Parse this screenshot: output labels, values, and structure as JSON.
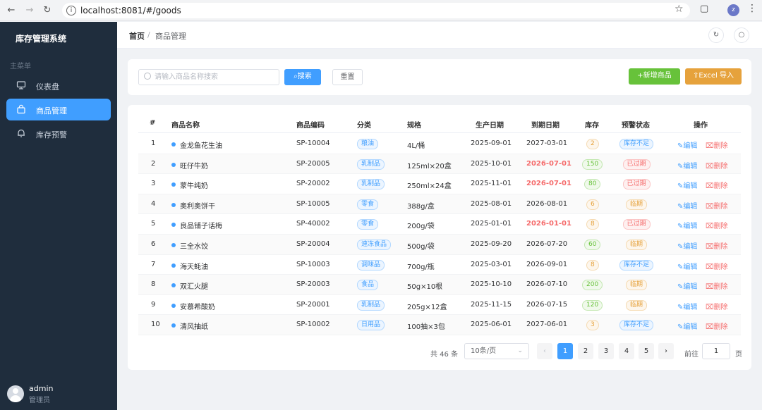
{
  "browser": {
    "url": "localhost:8081/#/goods",
    "profile_initial": "z"
  },
  "sidebar": {
    "brand": "库存管理系统",
    "section_label": "主菜单",
    "items": [
      {
        "label": "仪表盘",
        "icon": "monitor-icon"
      },
      {
        "label": "商品管理",
        "icon": "shopping-bag-icon"
      },
      {
        "label": "库存预警",
        "icon": "bell-icon"
      }
    ],
    "user": {
      "name": "admin",
      "role": "管理员"
    }
  },
  "header": {
    "breadcrumb_home": "首页",
    "breadcrumb_separator": "/",
    "breadcrumb_current": "商品管理"
  },
  "toolbar": {
    "search_placeholder": "请输入商品名称搜索",
    "search_value": "",
    "search_button": "搜索",
    "reset_button": "重置",
    "add_button": "+新增商品",
    "import_button": "Excel 导入"
  },
  "table": {
    "columns": [
      "#",
      "商品名称",
      "商品编码",
      "分类",
      "规格",
      "生产日期",
      "到期日期",
      "库存",
      "预警状态",
      "操作"
    ],
    "edit_label": "编辑",
    "delete_label": "删除",
    "rows": [
      {
        "idx": "1",
        "name": "金龙鱼花生油",
        "code": "SP-10004",
        "category": "粮油",
        "spec": "4L/桶",
        "prod": "2025-09-01",
        "exp": "2027-03-01",
        "exp_expired": false,
        "stock": "2",
        "stock_level": "low",
        "status": "库存不足",
        "status_type": "info"
      },
      {
        "idx": "2",
        "name": "旺仔牛奶",
        "code": "SP-20005",
        "category": "乳制品",
        "spec": "125ml×20盒",
        "prod": "2025-10-01",
        "exp": "2026-07-01",
        "exp_expired": true,
        "stock": "150",
        "stock_level": "ok",
        "status": "已过期",
        "status_type": "danger"
      },
      {
        "idx": "3",
        "name": "蒙牛纯奶",
        "code": "SP-20002",
        "category": "乳制品",
        "spec": "250ml×24盒",
        "prod": "2025-11-01",
        "exp": "2026-07-01",
        "exp_expired": true,
        "stock": "80",
        "stock_level": "ok",
        "status": "已过期",
        "status_type": "danger"
      },
      {
        "idx": "4",
        "name": "奥利奥饼干",
        "code": "SP-10005",
        "category": "零食",
        "spec": "388g/盒",
        "prod": "2025-08-01",
        "exp": "2026-08-01",
        "exp_expired": false,
        "stock": "6",
        "stock_level": "low",
        "status": "临期",
        "status_type": "warning"
      },
      {
        "idx": "5",
        "name": "良品铺子话梅",
        "code": "SP-40002",
        "category": "零食",
        "spec": "200g/袋",
        "prod": "2025-01-01",
        "exp": "2026-01-01",
        "exp_expired": true,
        "stock": "8",
        "stock_level": "low",
        "status": "已过期",
        "status_type": "danger"
      },
      {
        "idx": "6",
        "name": "三全水饺",
        "code": "SP-20004",
        "category": "速冻食品",
        "spec": "500g/袋",
        "prod": "2025-09-20",
        "exp": "2026-07-20",
        "exp_expired": false,
        "stock": "60",
        "stock_level": "ok",
        "status": "临期",
        "status_type": "warning"
      },
      {
        "idx": "7",
        "name": "海天蚝油",
        "code": "SP-10003",
        "category": "调味品",
        "spec": "700g/瓶",
        "prod": "2025-03-01",
        "exp": "2026-09-01",
        "exp_expired": false,
        "stock": "8",
        "stock_level": "low",
        "status": "库存不足",
        "status_type": "info"
      },
      {
        "idx": "8",
        "name": "双汇火腿",
        "code": "SP-20003",
        "category": "食品",
        "spec": "50g×10根",
        "prod": "2025-10-10",
        "exp": "2026-07-10",
        "exp_expired": false,
        "stock": "200",
        "stock_level": "ok",
        "status": "临期",
        "status_type": "warning"
      },
      {
        "idx": "9",
        "name": "安慕希酸奶",
        "code": "SP-20001",
        "category": "乳制品",
        "spec": "205g×12盒",
        "prod": "2025-11-15",
        "exp": "2026-07-15",
        "exp_expired": false,
        "stock": "120",
        "stock_level": "ok",
        "status": "临期",
        "status_type": "warning"
      },
      {
        "idx": "10",
        "name": "清风抽纸",
        "code": "SP-10002",
        "category": "日用品",
        "spec": "100抽×3包",
        "prod": "2025-06-01",
        "exp": "2027-06-01",
        "exp_expired": false,
        "stock": "3",
        "stock_level": "low",
        "status": "库存不足",
        "status_type": "info"
      }
    ]
  },
  "pagination": {
    "total_text": "共 46 条",
    "page_size": "10条/页",
    "pages": [
      "1",
      "2",
      "3",
      "4",
      "5"
    ],
    "current_page": "1",
    "goto_label": "前往",
    "goto_value": "1",
    "page_suffix": "页"
  },
  "colors": {
    "primary": "#409eff",
    "success": "#67c23a",
    "warning": "#e6a23c",
    "danger": "#f56c6c",
    "sidebar": "#1f2d3d"
  }
}
